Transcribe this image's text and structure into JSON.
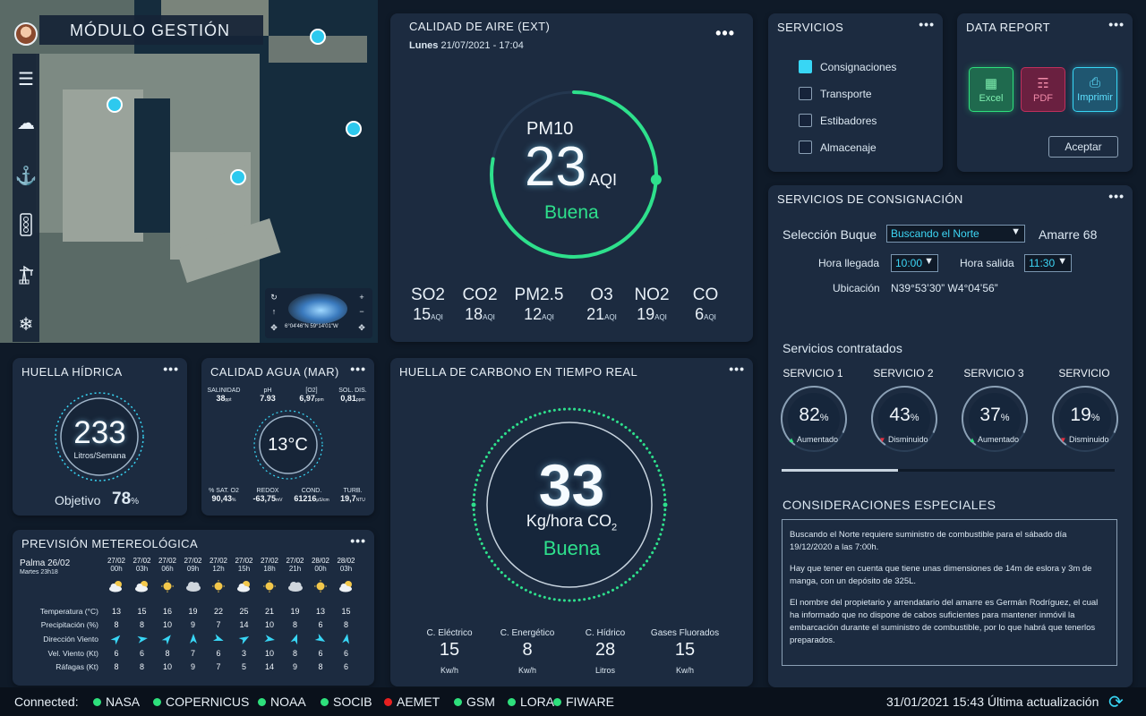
{
  "map": {
    "module_title": "MÓDULO GESTIÓN",
    "coords": "6°04'46\"N 59°14'01\"W"
  },
  "sidebar": {
    "icons": [
      "menu-icon",
      "weather-icon",
      "anchor-icon",
      "traffic-light-icon",
      "crane-icon",
      "helm-icon"
    ]
  },
  "air": {
    "title": "CALIDAD DE AIRE (EXT)",
    "day": "Lunes",
    "datetime": "21/07/2021 - 17:04",
    "main_label": "PM10",
    "main_value": "23",
    "main_unit": "AQI",
    "status": "Buena",
    "gauge_fraction": 0.78,
    "pollutants": [
      {
        "name": "SO2",
        "value": "15",
        "unit": "AQI"
      },
      {
        "name": "CO2",
        "value": "18",
        "unit": "AQI"
      },
      {
        "name": "PM2.5",
        "value": "12",
        "unit": "AQI"
      },
      {
        "name": "O3",
        "value": "21",
        "unit": "AQI"
      },
      {
        "name": "NO2",
        "value": "19",
        "unit": "AQI"
      },
      {
        "name": "CO",
        "value": "6",
        "unit": "AQI"
      }
    ]
  },
  "servicios": {
    "title": "SERVICIOS",
    "items": [
      {
        "label": "Consignaciones",
        "checked": true
      },
      {
        "label": "Transporte",
        "checked": false
      },
      {
        "label": "Estibadores",
        "checked": false
      },
      {
        "label": "Almacenaje",
        "checked": false
      }
    ]
  },
  "report": {
    "title": "DATA REPORT",
    "excel": "Excel",
    "pdf": "PDF",
    "print": "Imprimir",
    "accept": "Aceptar"
  },
  "consig": {
    "title": "SERVICIOS DE CONSIGNACIÓN",
    "ship_label": "Selección Buque",
    "ship_value": "Buscando el Norte",
    "berth": "Amarre 68",
    "arrival_label": "Hora llegada",
    "arrival_value": "10:00",
    "departure_label": "Hora salida",
    "departure_value": "11:30",
    "location_label": "Ubicación",
    "location_value": "N39°53’30” W4°04’56”",
    "contracted_label": "Servicios contratados",
    "services": [
      {
        "name": "SERVICIO 1",
        "pct": "82",
        "trend": "Aumentado",
        "up": true,
        "fraction": 0.82
      },
      {
        "name": "SERVICIO 2",
        "pct": "43",
        "trend": "Disminuido",
        "up": false,
        "fraction": 0.43
      },
      {
        "name": "SERVICIO 3",
        "pct": "37",
        "trend": "Aumentado",
        "up": true,
        "fraction": 0.37
      },
      {
        "name": "SERVICIO",
        "pct": "19",
        "trend": "Disminuido",
        "up": false,
        "fraction": 0.19
      }
    ],
    "scroll_fraction": 0.35
  },
  "special": {
    "title": "CONSIDERACIONES ESPECIALES",
    "p1": "Buscando el Norte requiere suministro de combustible para el sábado día 19/12/2020 a las 7:00h.",
    "p2": "Hay que tener en cuenta que tiene unas dimensiones de 14m de eslora y 3m de manga, con un depósito de 325L.",
    "p3": "El nombre del propietario y arrendatario del amarre es Germán Rodríguez, el cual ha informado que no dispone de cabos suficientes para mantener inmóvil la embarcación durante el suministro de combustible, por lo que habrá que tenerlos preparados."
  },
  "hidrica": {
    "title": "HUELLA HÍDRICA",
    "value": "233",
    "unit": "Litros/Semana",
    "goal_label": "Objetivo",
    "goal_value": "78",
    "goal_unit": "%"
  },
  "agua": {
    "title": "CALIDAD AGUA (MAR)",
    "temp": "13°C",
    "top": [
      {
        "label": "SALINIDAD",
        "value": "38",
        "unit": "ppt"
      },
      {
        "label": "pH",
        "value": "7.93",
        "unit": ""
      },
      {
        "label": "[O2]",
        "value": "6,97",
        "unit": "ppm"
      },
      {
        "label": "SOL. DIS.",
        "value": "0,81",
        "unit": "ppm"
      }
    ],
    "bottom": [
      {
        "label": "% SAT. O2",
        "value": "90,43",
        "unit": "%"
      },
      {
        "label": "REDOX",
        "value": "-63,75",
        "unit": "mV"
      },
      {
        "label": "COND.",
        "value": "61216",
        "unit": "μS/cm"
      },
      {
        "label": "TURB.",
        "value": "19,7",
        "unit": "NTU"
      }
    ]
  },
  "carbono": {
    "title": "HUELLA DE CARBONO EN TIEMPO REAL",
    "value": "33",
    "unit": "Kg/hora CO",
    "unit_sub": "2",
    "status": "Buena",
    "stats": [
      {
        "label": "C. Eléctrico",
        "value": "15",
        "unit": "Kw/h"
      },
      {
        "label": "C. Energético",
        "value": "8",
        "unit": "Kw/h"
      },
      {
        "label": "C. Hídrico",
        "value": "28",
        "unit": "Litros"
      },
      {
        "label": "Gases Fluorados",
        "value": "15",
        "unit": "Kw/h"
      }
    ]
  },
  "forecast": {
    "title": "PREVISIÓN METEREOLÓGICA",
    "place": "Palma 26/02",
    "sub": "Martes 23h18",
    "rows": [
      "Temperatura (°C)",
      "Precipitación (%)",
      "Dirección Viento",
      "Vel. Viento (Kt)",
      "Ráfagas (Kt)"
    ],
    "cols": [
      {
        "date": "27/02",
        "hour": "00h",
        "icon": "partly-cloudy-icon",
        "temp": "13",
        "prec": "8",
        "wind_dir": 45,
        "vel": "6",
        "gust": "8"
      },
      {
        "date": "27/02",
        "hour": "03h",
        "icon": "partly-cloudy-icon",
        "temp": "15",
        "prec": "8",
        "wind_dir": 80,
        "vel": "6",
        "gust": "8"
      },
      {
        "date": "27/02",
        "hour": "06h",
        "icon": "sun-icon",
        "temp": "16",
        "prec": "10",
        "wind_dir": 40,
        "vel": "8",
        "gust": "10"
      },
      {
        "date": "27/02",
        "hour": "09h",
        "icon": "cloud-icon",
        "temp": "19",
        "prec": "9",
        "wind_dir": 0,
        "vel": "7",
        "gust": "9"
      },
      {
        "date": "27/02",
        "hour": "12h",
        "icon": "sun-icon",
        "temp": "22",
        "prec": "7",
        "wind_dir": 110,
        "vel": "6",
        "gust": "7"
      },
      {
        "date": "27/02",
        "hour": "15h",
        "icon": "partly-cloudy-icon",
        "temp": "25",
        "prec": "14",
        "wind_dir": 60,
        "vel": "3",
        "gust": "5"
      },
      {
        "date": "27/02",
        "hour": "18h",
        "icon": "sun-icon",
        "temp": "21",
        "prec": "10",
        "wind_dir": 100,
        "vel": "10",
        "gust": "14"
      },
      {
        "date": "27/02",
        "hour": "21h",
        "icon": "cloud-icon",
        "temp": "19",
        "prec": "8",
        "wind_dir": 20,
        "vel": "8",
        "gust": "9"
      },
      {
        "date": "28/02",
        "hour": "00h",
        "icon": "sun-icon",
        "temp": "13",
        "prec": "6",
        "wind_dir": 120,
        "vel": "6",
        "gust": "8"
      },
      {
        "date": "28/02",
        "hour": "03h",
        "icon": "partly-cloudy-icon",
        "temp": "15",
        "prec": "8",
        "wind_dir": 10,
        "vel": "6",
        "gust": "6"
      }
    ]
  },
  "footer": {
    "connected_label": "Connected:",
    "sources": [
      {
        "name": "NASA",
        "color": "#2ee07c"
      },
      {
        "name": "COPERNICUS",
        "color": "#2ee07c"
      },
      {
        "name": "NOAA",
        "color": "#2ee07c"
      },
      {
        "name": "SOCIB",
        "color": "#2ee07c"
      },
      {
        "name": "AEMET",
        "color": "#e82020"
      },
      {
        "name": "GSM",
        "color": "#2ee07c"
      },
      {
        "name": "LORA",
        "color": "#2ee07c"
      },
      {
        "name": "FIWARE",
        "color": "#2ee07c"
      }
    ],
    "updated": "31/01/2021 15:43 Última actualización"
  },
  "colors": {
    "accent": "#2ee0a0",
    "cyan": "#38d6f5",
    "up": "#2ee07c",
    "down": "#e83040"
  }
}
